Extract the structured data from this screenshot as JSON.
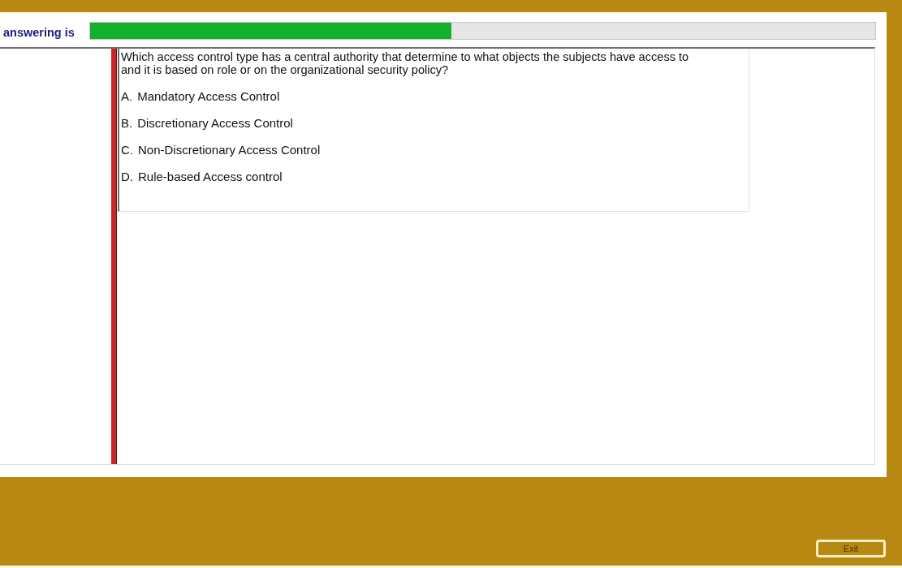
{
  "progress": {
    "label": "answering is",
    "level": 0.46
  },
  "question": {
    "text": "Which access control type has a central authority that determine to what objects the subjects have access to and it is based on role or on the organizational security policy?",
    "options": [
      {
        "letter": "A.",
        "text": "Mandatory Access Control"
      },
      {
        "letter": "B.",
        "text": "Discretionary Access Control"
      },
      {
        "letter": "C.",
        "text": "Non-Discretionary Access Control"
      },
      {
        "letter": "D.",
        "text": "Rule-based Access control"
      }
    ]
  },
  "exit_button": {
    "label": "Exit"
  }
}
